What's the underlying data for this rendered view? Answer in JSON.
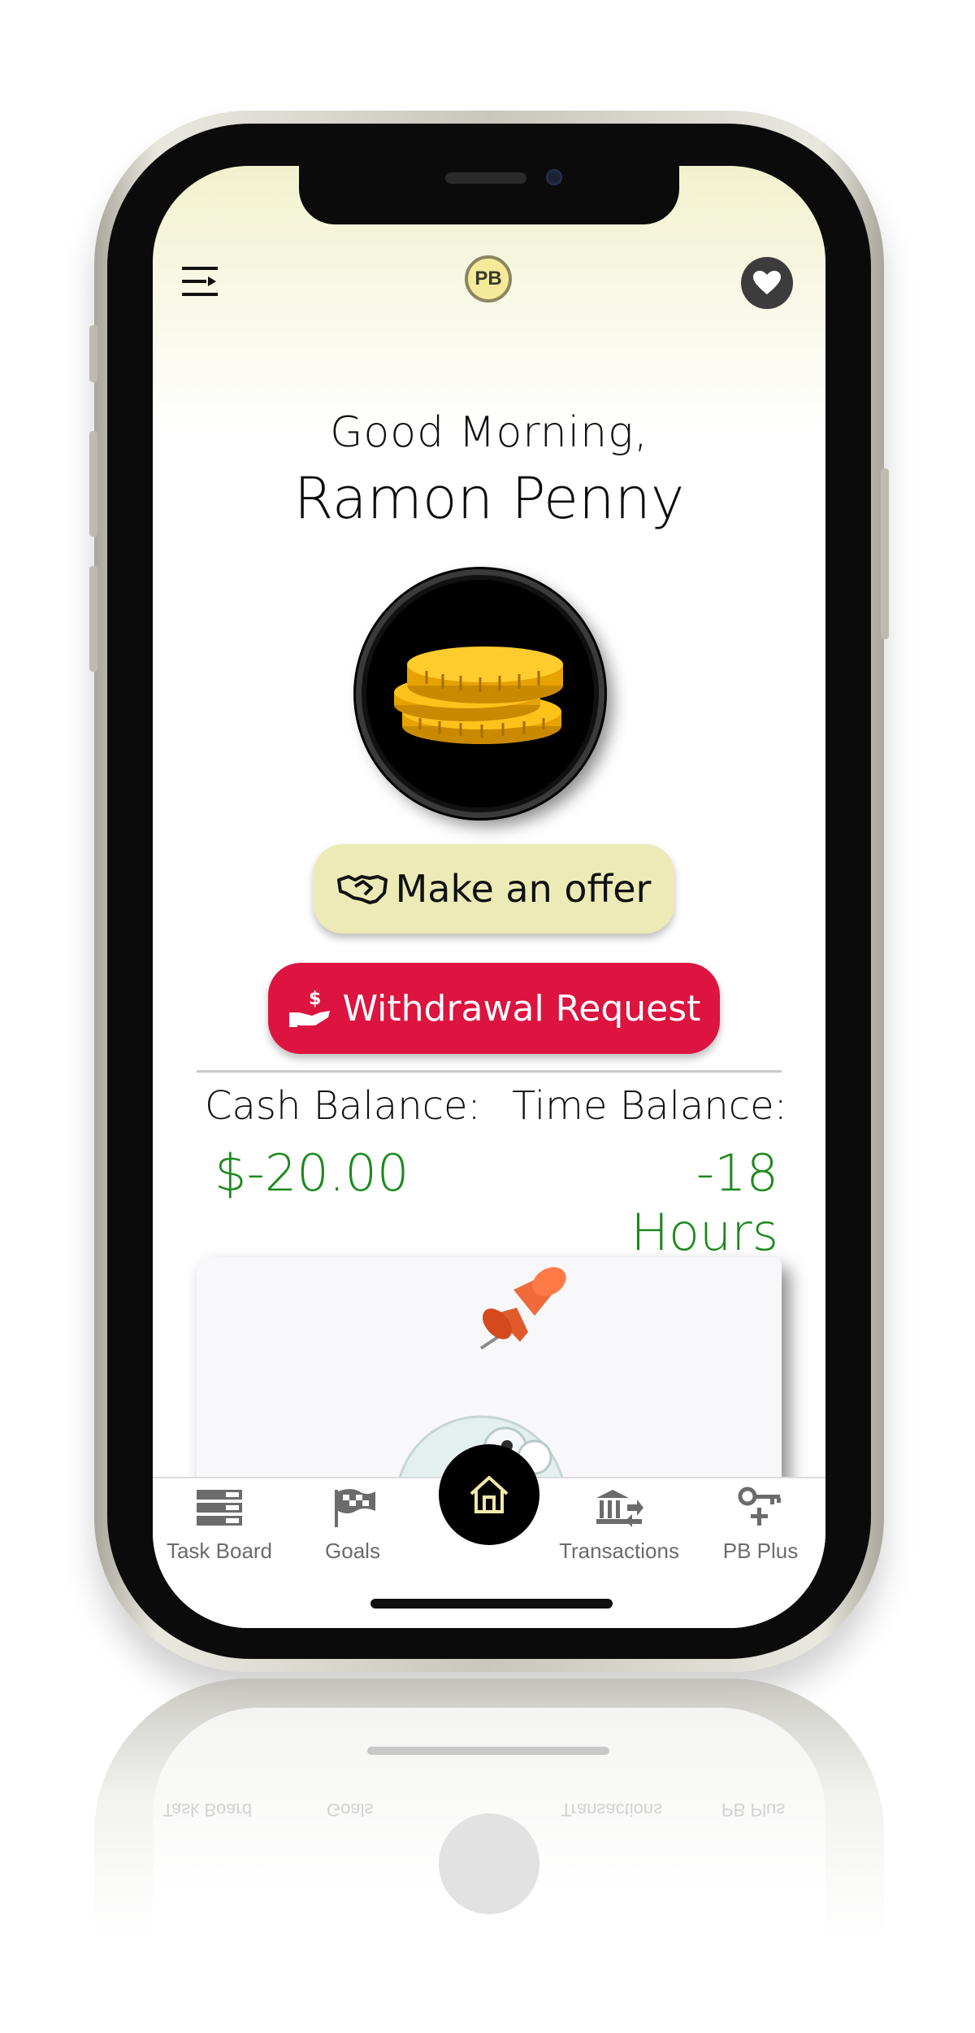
{
  "header": {
    "menu_icon": "menu-icon",
    "logo_text": "PB",
    "favorite_icon": "heart-icon"
  },
  "greeting": {
    "salutation": "Good Morning,",
    "name": "Ramon Penny"
  },
  "coin_badge_icon": "coins-icon",
  "actions": {
    "offer_label": "Make an offer",
    "offer_icon": "handshake-icon",
    "withdraw_label": "Withdrawal Request",
    "withdraw_icon": "hand-dollar-icon"
  },
  "balances": {
    "cash_label": "Cash Balance:",
    "cash_value": "$-20.00",
    "time_label": "Time Balance:",
    "time_value": "-18 Hours"
  },
  "task_card": {
    "pin_icon": "pushpin-icon",
    "mascot_icon": "mascot-icon"
  },
  "tabs": [
    {
      "label": "Task Board",
      "icon": "task-board-icon"
    },
    {
      "label": "Goals",
      "icon": "flag-icon"
    },
    {
      "label": "Home",
      "icon": "home-icon"
    },
    {
      "label": "Transactions",
      "icon": "bank-transfer-icon"
    },
    {
      "label": "PB Plus",
      "icon": "key-plus-icon"
    }
  ],
  "colors": {
    "accent_red": "#dc143f",
    "offer_yellow": "#ecebb7",
    "balance_green": "#1c8a1c",
    "header_tint": "#f2f1ce"
  }
}
